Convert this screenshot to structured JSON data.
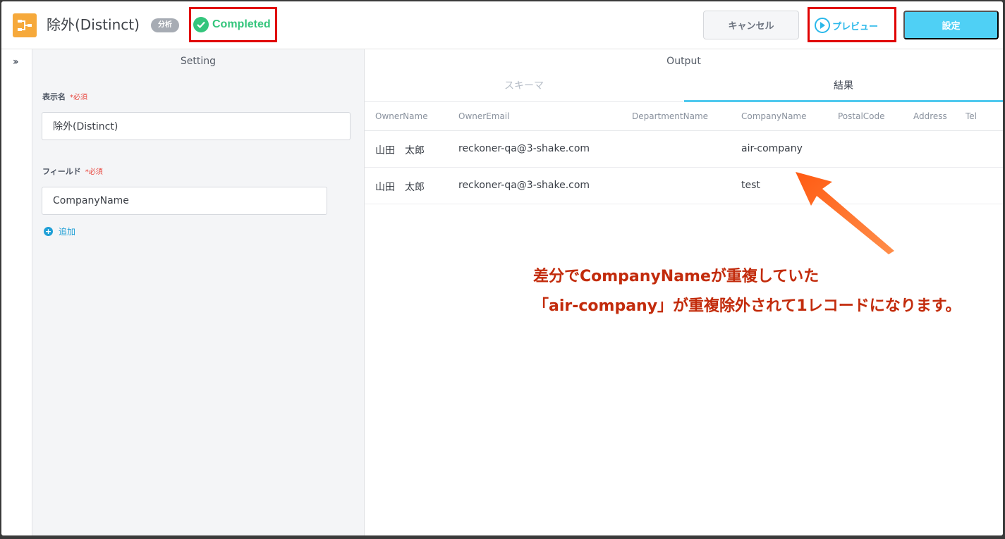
{
  "header": {
    "title": "除外(Distinct)",
    "tag": "分析",
    "status": "Completed",
    "cancel_label": "キャンセル",
    "preview_label": "プレビュー",
    "settings_label": "設定"
  },
  "setting_panel": {
    "title": "Setting",
    "display_name_label": "表示名",
    "display_name_required": "*必須",
    "display_name_value": "除外(Distinct)",
    "field_label": "フィールド",
    "field_required": "*必須",
    "field_value": "CompanyName",
    "add_label": "追加"
  },
  "output_panel": {
    "title": "Output",
    "tabs": [
      {
        "label": "スキーマ",
        "active": false
      },
      {
        "label": "結果",
        "active": true
      }
    ],
    "columns": [
      "OwnerName",
      "OwnerEmail",
      "DepartmentName",
      "CompanyName",
      "PostalCode",
      "Address",
      "Tel"
    ],
    "rows": [
      [
        "山田　太郎",
        "reckoner-qa@3-shake.com",
        "",
        "air-company",
        "",
        "",
        ""
      ],
      [
        "山田　太郎",
        "reckoner-qa@3-shake.com",
        "",
        "test",
        "",
        "",
        ""
      ]
    ]
  },
  "annotation": {
    "line1": "差分でCompanyNameが重複していた",
    "line2": "「air-company」が重複除外されて1レコードになります。"
  },
  "colors": {
    "accent": "#4fd0f5",
    "status_green": "#34c57c",
    "highlight_red": "#e00000",
    "annotation_red": "#c22b0c"
  }
}
